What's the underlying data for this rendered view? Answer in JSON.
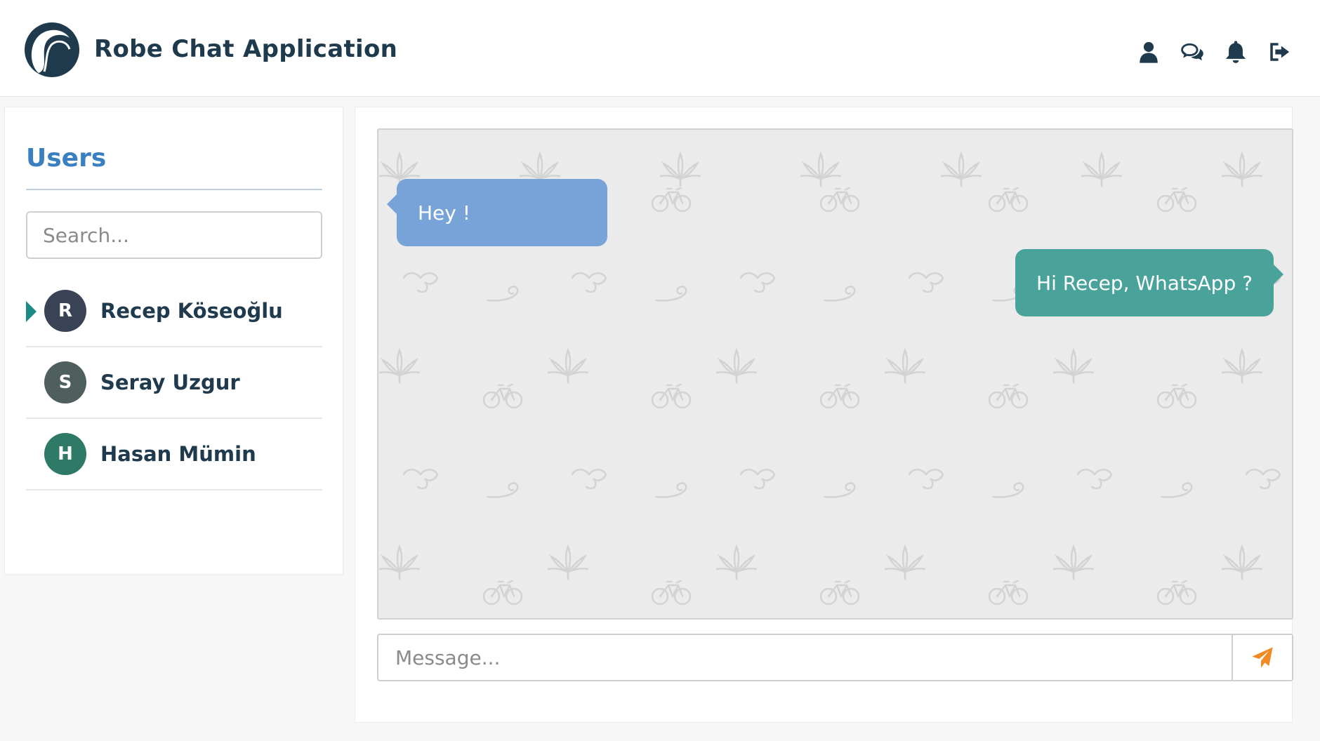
{
  "header": {
    "title": "Robe Chat Application",
    "icons": [
      "user-icon",
      "chat-bubbles-icon",
      "bell-icon",
      "sign-out-icon"
    ]
  },
  "sidebar": {
    "title": "Users",
    "search": {
      "placeholder": "Search...",
      "value": ""
    },
    "users": [
      {
        "initial": "R",
        "name": "Recep Köseoğlu",
        "avatar_color": "#3a4256",
        "active": true
      },
      {
        "initial": "S",
        "name": "Seray Uzgur",
        "avatar_color": "#4f5f5e",
        "active": false
      },
      {
        "initial": "H",
        "name": "Hasan Mümin",
        "avatar_color": "#2f7a66",
        "active": false
      }
    ]
  },
  "chat": {
    "messages": [
      {
        "direction": "incoming",
        "text": "Hey !"
      },
      {
        "direction": "outgoing",
        "text": "Hi Recep, WhatsApp ?"
      }
    ],
    "input": {
      "placeholder": "Message...",
      "value": ""
    }
  },
  "colors": {
    "brand_dark": "#1e3a4c",
    "users_title": "#3a7fbf",
    "incoming_bubble": "#77a3d8",
    "outgoing_bubble": "#4aa39b",
    "active_marker": "#1e8a88",
    "send_icon": "#f08a24",
    "chat_background": "#ebebeb"
  }
}
